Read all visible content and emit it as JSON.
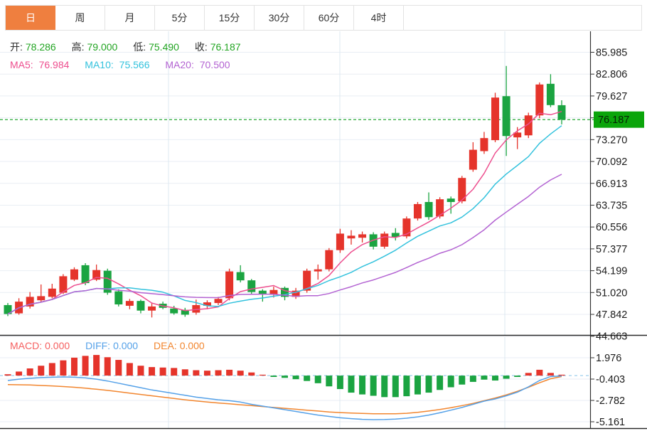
{
  "tabs": {
    "items": [
      {
        "label": "日",
        "active": true
      },
      {
        "label": "周",
        "active": false
      },
      {
        "label": "月",
        "active": false
      },
      {
        "label": "5分",
        "active": false
      },
      {
        "label": "15分",
        "active": false
      },
      {
        "label": "30分",
        "active": false
      },
      {
        "label": "60分",
        "active": false
      },
      {
        "label": "4时",
        "active": false
      }
    ]
  },
  "legend": {
    "ohlc": [
      {
        "label": "开:",
        "value": "78.286"
      },
      {
        "label": "高:",
        "value": "79.000"
      },
      {
        "label": "低:",
        "value": "75.490"
      },
      {
        "label": "收:",
        "value": "76.187"
      }
    ],
    "ma": [
      {
        "label": "MA5:",
        "value": "76.984"
      },
      {
        "label": "MA10:",
        "value": "75.566"
      },
      {
        "label": "MA20:",
        "value": "70.500"
      }
    ],
    "macd": [
      {
        "label": "MACD:",
        "value": "0.000"
      },
      {
        "label": "DIFF:",
        "value": "0.000"
      },
      {
        "label": "DEA:",
        "value": "0.000"
      }
    ]
  },
  "colors": {
    "accent_tab": "#ef7f3f",
    "up": "#e5342b",
    "down": "#1ba441",
    "ma5": "#ed4e8e",
    "ma10": "#33c2dd",
    "ma20": "#b363d2",
    "diff": "#55a1e8",
    "dea": "#f2862f",
    "macd_label": "#f56060",
    "ohlc_value": "#21a421",
    "price_badge_bg": "#0ba50b",
    "price_line": "#0f9f1f",
    "zero_line": "#aed6f0",
    "grid": "#e9eef4",
    "axis": "#333333",
    "tick_text": "#1b1b1b"
  },
  "chart_data": {
    "type": "candlestick_with_macd",
    "timeframe_selected": "日",
    "current_price": "76.187",
    "price_axis_ticks": [
      "85.985",
      "82.806",
      "79.627",
      "",
      "73.270",
      "70.092",
      "66.913",
      "63.735",
      "60.556",
      "57.377",
      "54.199",
      "51.020",
      "47.842",
      "44.663"
    ],
    "macd_axis_ticks": [
      "1.976",
      "-0.403",
      "-2.782",
      "-5.161"
    ],
    "ylim_price": [
      44.85,
      89.04
    ],
    "ylim_macd": [
      -5.86,
      4.29
    ],
    "ma_periods": [
      5,
      10,
      20
    ],
    "grid": "on",
    "candles_ohlc": [
      [
        49.2,
        49.5,
        47.6,
        47.9
      ],
      [
        48.0,
        50.2,
        47.8,
        49.7
      ],
      [
        49.0,
        51.1,
        48.7,
        50.4
      ],
      [
        49.9,
        52.2,
        49.7,
        50.5
      ],
      [
        50.4,
        52.3,
        50.2,
        51.6
      ],
      [
        51.0,
        53.7,
        50.8,
        53.4
      ],
      [
        52.9,
        54.7,
        52.7,
        54.4
      ],
      [
        55.0,
        55.3,
        52.1,
        52.4
      ],
      [
        52.9,
        55.1,
        52.7,
        54.3
      ],
      [
        54.2,
        54.5,
        50.7,
        51.0
      ],
      [
        51.2,
        51.5,
        49.0,
        49.3
      ],
      [
        49.1,
        50.1,
        48.6,
        49.8
      ],
      [
        49.8,
        50.0,
        48.0,
        48.4
      ],
      [
        48.4,
        49.5,
        47.4,
        49.0
      ],
      [
        49.4,
        49.7,
        48.6,
        48.8
      ],
      [
        48.7,
        49.1,
        47.8,
        48.0
      ],
      [
        48.5,
        48.8,
        47.5,
        47.8
      ],
      [
        48.1,
        50.0,
        47.8,
        49.2
      ],
      [
        49.1,
        49.9,
        48.6,
        49.6
      ],
      [
        49.5,
        50.4,
        49.2,
        50.1
      ],
      [
        50.2,
        54.5,
        49.9,
        54.1
      ],
      [
        54.0,
        55.0,
        52.5,
        52.8
      ],
      [
        52.8,
        53.0,
        50.8,
        51.1
      ],
      [
        51.3,
        51.5,
        49.7,
        50.8
      ],
      [
        50.7,
        51.9,
        50.3,
        51.4
      ],
      [
        51.7,
        51.9,
        49.9,
        50.4
      ],
      [
        50.4,
        51.7,
        50.1,
        51.3
      ],
      [
        51.3,
        54.5,
        51.0,
        54.2
      ],
      [
        54.1,
        55.1,
        52.9,
        54.4
      ],
      [
        54.4,
        57.5,
        54.1,
        57.2
      ],
      [
        57.2,
        60.3,
        56.8,
        59.6
      ],
      [
        58.9,
        60.1,
        58.0,
        59.3
      ],
      [
        59.0,
        59.9,
        58.3,
        59.5
      ],
      [
        59.5,
        59.8,
        57.3,
        57.7
      ],
      [
        57.7,
        59.9,
        57.4,
        59.6
      ],
      [
        59.7,
        60.4,
        58.6,
        59.1
      ],
      [
        59.2,
        62.1,
        58.9,
        61.8
      ],
      [
        61.8,
        64.2,
        61.5,
        63.9
      ],
      [
        64.2,
        65.6,
        61.6,
        62.0
      ],
      [
        62.1,
        64.9,
        61.8,
        64.6
      ],
      [
        64.7,
        65.0,
        62.5,
        64.2
      ],
      [
        64.3,
        68.0,
        64.0,
        67.7
      ],
      [
        68.9,
        72.9,
        68.6,
        71.8
      ],
      [
        71.6,
        74.4,
        71.2,
        73.5
      ],
      [
        73.2,
        80.1,
        72.9,
        79.4
      ],
      [
        79.6,
        84.0,
        70.9,
        73.8
      ],
      [
        73.6,
        75.1,
        71.9,
        74.3
      ],
      [
        73.9,
        77.2,
        73.5,
        76.8
      ],
      [
        76.8,
        81.6,
        76.4,
        81.3
      ],
      [
        81.4,
        82.8,
        78.0,
        78.3
      ],
      [
        78.286,
        79.0,
        75.49,
        76.187
      ]
    ],
    "macd": {
      "hist": [
        0.15,
        0.45,
        0.8,
        1.1,
        1.4,
        1.7,
        2.0,
        2.2,
        2.3,
        2.05,
        1.75,
        1.4,
        1.1,
        0.95,
        0.9,
        0.85,
        0.7,
        0.6,
        0.55,
        0.6,
        0.65,
        0.55,
        0.35,
        0.1,
        -0.15,
        -0.25,
        -0.4,
        -0.6,
        -0.85,
        -1.2,
        -1.5,
        -1.9,
        -2.1,
        -2.25,
        -2.4,
        -2.4,
        -2.3,
        -2.1,
        -1.9,
        -1.6,
        -1.3,
        -1.0,
        -0.7,
        -0.45,
        -0.55,
        -0.35,
        -0.15,
        0.3,
        0.65,
        0.3,
        0.1
      ],
      "diff": [
        -0.55,
        -0.4,
        -0.3,
        -0.22,
        -0.18,
        -0.15,
        -0.18,
        -0.25,
        -0.4,
        -0.6,
        -0.85,
        -1.1,
        -1.35,
        -1.6,
        -1.8,
        -2.0,
        -2.2,
        -2.4,
        -2.55,
        -2.7,
        -2.8,
        -2.95,
        -3.2,
        -3.4,
        -3.6,
        -3.8,
        -4.0,
        -4.2,
        -4.4,
        -4.55,
        -4.7,
        -4.8,
        -4.88,
        -4.92,
        -4.9,
        -4.85,
        -4.75,
        -4.6,
        -4.4,
        -4.15,
        -3.85,
        -3.55,
        -3.2,
        -2.85,
        -2.6,
        -2.25,
        -1.85,
        -1.25,
        -0.55,
        -0.1,
        -0.05
      ],
      "dea": [
        -1.0,
        -1.02,
        -1.05,
        -1.1,
        -1.15,
        -1.22,
        -1.3,
        -1.4,
        -1.52,
        -1.65,
        -1.8,
        -1.95,
        -2.1,
        -2.25,
        -2.4,
        -2.55,
        -2.7,
        -2.82,
        -2.94,
        -3.05,
        -3.15,
        -3.25,
        -3.35,
        -3.45,
        -3.55,
        -3.65,
        -3.75,
        -3.85,
        -3.95,
        -4.05,
        -4.12,
        -4.18,
        -4.22,
        -4.25,
        -4.26,
        -4.25,
        -4.2,
        -4.1,
        -3.95,
        -3.78,
        -3.58,
        -3.35,
        -3.1,
        -2.8,
        -2.5,
        -2.15,
        -1.75,
        -1.3,
        -0.8,
        -0.35,
        -0.1
      ]
    }
  }
}
